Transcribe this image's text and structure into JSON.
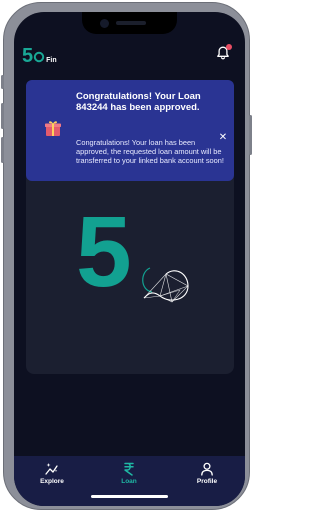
{
  "header": {
    "logo_number": "5",
    "logo_sub": "Fin"
  },
  "toast": {
    "title": "Congratulations! Your Loan 843244 has been approved.",
    "message": "Congratulations! Your loan has been approved, the requested loan amount will be transferred to your linked bank account soon!",
    "close_symbol": "✕",
    "icon": "gift-icon"
  },
  "hero": {
    "number": "5",
    "graphic": "loop-icon"
  },
  "tabs": [
    {
      "label": "Explore",
      "icon": "sparkle-chart-icon",
      "active": false
    },
    {
      "label": "Loan",
      "icon": "rupee-icon",
      "active": true
    },
    {
      "label": "Profile",
      "icon": "person-icon",
      "active": false
    }
  ],
  "colors": {
    "accent": "#19a896",
    "background": "#0d1021",
    "toast": "#2a3493",
    "tabbar": "#181d45",
    "notification_dot": "#e94e64"
  }
}
